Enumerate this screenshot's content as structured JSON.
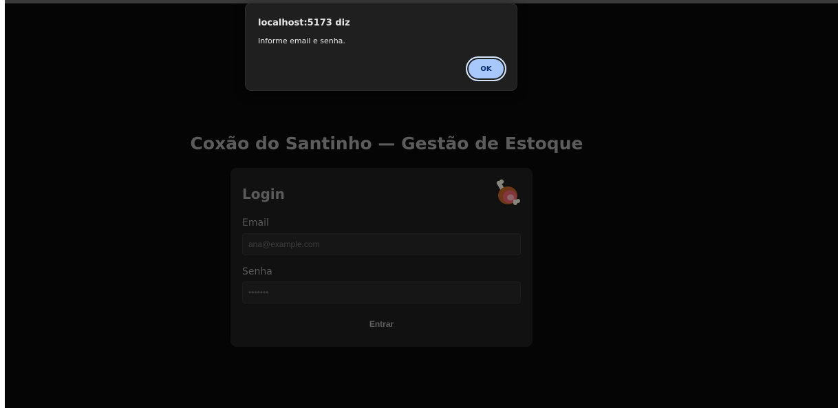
{
  "app": {
    "title": "Coxão do Santinho — Gestão de Estoque"
  },
  "login": {
    "heading": "Login",
    "icon": "meat-on-bone-icon",
    "email_label": "Email",
    "email_placeholder": "ana@example.com",
    "password_label": "Senha",
    "password_placeholder": "•••••••",
    "submit_label": "Entrar"
  },
  "dialog": {
    "title": "localhost:5173 diz",
    "message": "Informe email e senha.",
    "ok_label": "OK"
  },
  "colors": {
    "page_background": "#050505",
    "card_background": "#111111",
    "dialog_background": "#1f1f1f",
    "ok_button": "#a8c7fa"
  }
}
